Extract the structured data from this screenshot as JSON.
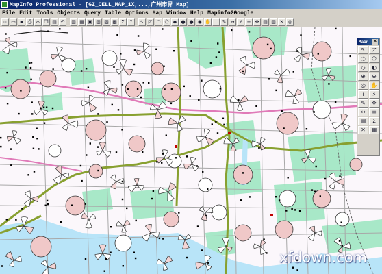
{
  "window": {
    "title": "MapInfo Professional - [GZ_CELL_MAP_1X,...,广州市界 Map]"
  },
  "menubar": {
    "items": [
      "File",
      "Edit",
      "Tools",
      "Objects",
      "Query",
      "Table",
      "Options",
      "Map",
      "Window",
      "Help",
      "Mapinfo2Google"
    ]
  },
  "toolbar": {
    "buttons": [
      "new-icon",
      "open-icon",
      "save-icon",
      "print-icon",
      "cut-icon",
      "copy-icon",
      "paste-icon",
      "undo-icon",
      "grapher-icon",
      "browser-icon",
      "layout-icon",
      "redistrict-icon",
      "mapper-icon",
      "legend-icon",
      "stats-icon",
      "help-icon",
      "select-icon",
      "marquee-icon",
      "radius-icon",
      "polygon-icon",
      "boundary-icon",
      "zoom-in-icon",
      "zoom-out-icon",
      "change-view-icon",
      "grabber-icon",
      "info-icon",
      "label-icon",
      "ruler-icon",
      "hotlink-icon",
      "layer-control-icon",
      "drag-map-icon",
      "legend-window-icon",
      "show-statistics-icon",
      "clear-icon",
      "mapinfo2google-icon"
    ]
  },
  "palette": {
    "title": "Main",
    "close": "×",
    "buttons": [
      "arrow-select-icon",
      "marquee-icon",
      "radius-icon",
      "polygon-icon",
      "boundary-icon",
      "invert-icon",
      "zoom-in-icon",
      "zoom-out-icon",
      "change-view-icon",
      "grabber-icon",
      "info-icon",
      "hotlink-icon",
      "label-icon",
      "drag-icon",
      "ruler-icon",
      "layer-control-icon",
      "legend-icon",
      "statistics-icon",
      "clear-cosmetic-icon",
      "table-icon"
    ]
  },
  "watermark": {
    "text": "xfdown.com"
  },
  "colors": {
    "map_background": "#fbf7fb",
    "park_green": "#a8e8c8",
    "water_blue": "#b8e4f8",
    "road_pink": "#e07ab8",
    "highway_green": "#88a030",
    "site_circle_fill": "#f0c8c8",
    "grey_road": "#a8a8a8"
  }
}
